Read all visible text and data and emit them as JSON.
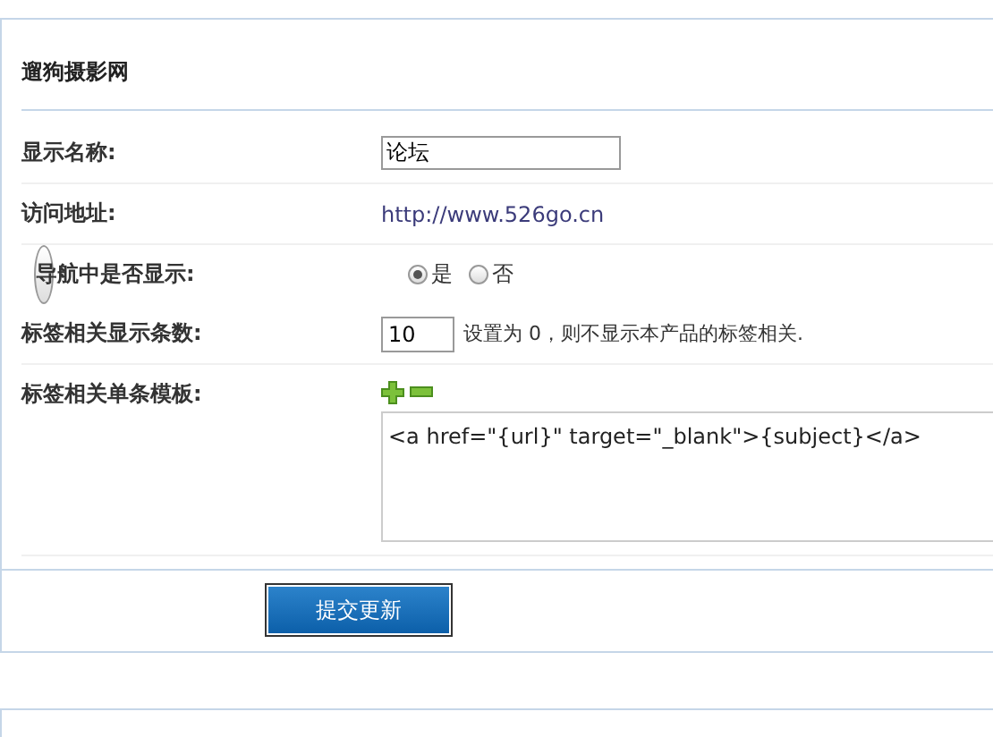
{
  "panel": {
    "title": "遛狗摄影网"
  },
  "fields": [
    {
      "kind": "input",
      "label": "显示名称:",
      "value": "论坛"
    },
    {
      "kind": "link",
      "label": "访问地址:",
      "value": "http://www.526go.cn"
    },
    {
      "kind": "radio",
      "label": "导航中是否显示:",
      "options": [
        {
          "label": "是",
          "selected": true
        },
        {
          "label": "否",
          "selected": false
        }
      ]
    },
    {
      "kind": "number",
      "label": "标签相关显示条数:",
      "value": "10",
      "note": "设置为 0，则不显示本产品的标签相关."
    },
    {
      "kind": "template",
      "label": "标签相关单条模板:",
      "value": "<a href=\"{url}\" target=\"_blank\">{subject}</a>"
    }
  ],
  "submit_button": {
    "label": "提交更新"
  }
}
